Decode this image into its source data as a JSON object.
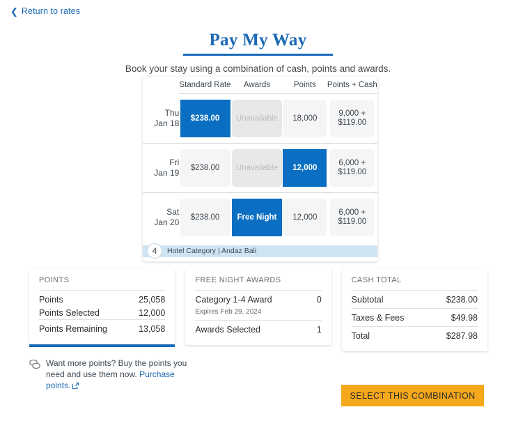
{
  "nav": {
    "back_label": "Return to rates",
    "back_icon": "chevron-left-icon"
  },
  "header": {
    "title": "Pay My Way",
    "subtitle": "Book your stay using a combination of cash, points and awards."
  },
  "rate_table": {
    "columns": [
      "Standard Rate",
      "Awards",
      "Points",
      "Points + Cash"
    ],
    "rows": [
      {
        "dow": "Thu",
        "date": "Jan 18",
        "standard_rate": {
          "label": "$238.00",
          "state": "selected"
        },
        "awards": {
          "label": "Unavailable",
          "state": "unavailable"
        },
        "points": {
          "label": "18,000",
          "state": "available"
        },
        "points_cash": {
          "line1": "9,000 +",
          "line2": "$119.00",
          "state": "available"
        }
      },
      {
        "dow": "Fri",
        "date": "Jan 19",
        "standard_rate": {
          "label": "$238.00",
          "state": "available"
        },
        "awards": {
          "label": "Unavailable",
          "state": "unavailable"
        },
        "points": {
          "label": "12,000",
          "state": "selected"
        },
        "points_cash": {
          "line1": "6,000 +",
          "line2": "$119.00",
          "state": "available"
        }
      },
      {
        "dow": "Sat",
        "date": "Jan 20",
        "standard_rate": {
          "label": "$238.00",
          "state": "available"
        },
        "awards": {
          "label": "Free Night",
          "state": "selected"
        },
        "points": {
          "label": "12,000",
          "state": "available"
        },
        "points_cash": {
          "line1": "6,000 +",
          "line2": "$119.00",
          "state": "available"
        }
      }
    ],
    "category_badge": "4",
    "category_text": "Hotel Category | Andaz Bali"
  },
  "summary": {
    "points_panel": {
      "title": "POINTS",
      "rows": [
        {
          "label": "Points",
          "value": "25,058"
        },
        {
          "label": "Points Selected",
          "value": "12,000"
        },
        {
          "label": "Points Remaining",
          "value": "13,058"
        }
      ]
    },
    "awards_panel": {
      "title": "FREE NIGHT AWARDS",
      "award_label": "Category 1-4 Award",
      "award_value": "0",
      "expires_note": "Expires Feb 29, 2024",
      "selected_label": "Awards Selected",
      "selected_value": "1"
    },
    "cash_panel": {
      "title": "CASH TOTAL",
      "rows": [
        {
          "label": "Subtotal",
          "value": "$238.00"
        },
        {
          "label": "Taxes & Fees",
          "value": "$49.98"
        },
        {
          "label": "Total",
          "value": "$287.98"
        }
      ]
    }
  },
  "buy_points": {
    "icon": "coins-icon",
    "text": "Want more points? Buy the points you need and use them now. ",
    "link_label": "Purchase points.",
    "link_icon": "external-link-icon"
  },
  "cta": {
    "label": "SELECT THIS COMBINATION"
  },
  "colors": {
    "brand_blue": "#1b69b6",
    "selected_blue": "#0a6fc2",
    "cta_orange": "#f5a81c",
    "category_bar": "#cfe4f3"
  }
}
